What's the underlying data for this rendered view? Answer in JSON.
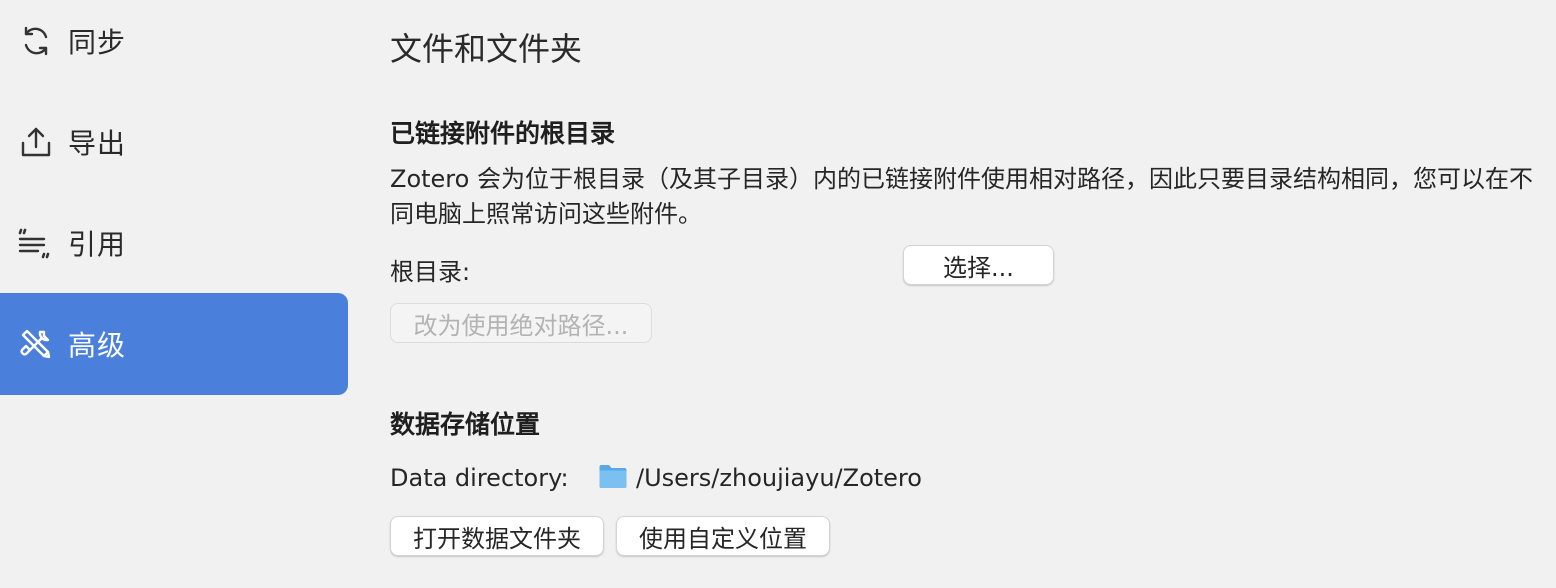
{
  "sidebar": {
    "items": [
      {
        "label": "同步",
        "icon": "sync-icon"
      },
      {
        "label": "导出",
        "icon": "export-icon"
      },
      {
        "label": "引用",
        "icon": "cite-icon"
      },
      {
        "label": "高级",
        "icon": "tools-icon",
        "active": true
      }
    ]
  },
  "main": {
    "title": "文件和文件夹",
    "linked_attachments": {
      "heading": "已链接附件的根目录",
      "description": "Zotero 会为位于根目录（及其子目录）内的已链接附件使用相对路径，因此只要目录结构相同，您可以在不同电脑上照常访问这些附件。",
      "root_label": "根目录:",
      "choose_button": "选择...",
      "absolute_button": "改为使用绝对路径..."
    },
    "data_storage": {
      "heading": "数据存储位置",
      "dir_label": "Data directory:",
      "path": "/Users/zhoujiayu/Zotero",
      "open_button": "打开数据文件夹",
      "custom_button": "使用自定义位置"
    }
  },
  "colors": {
    "accent": "#4a80dc",
    "background": "#f1f1f1",
    "folder": "#6fb6ee"
  }
}
